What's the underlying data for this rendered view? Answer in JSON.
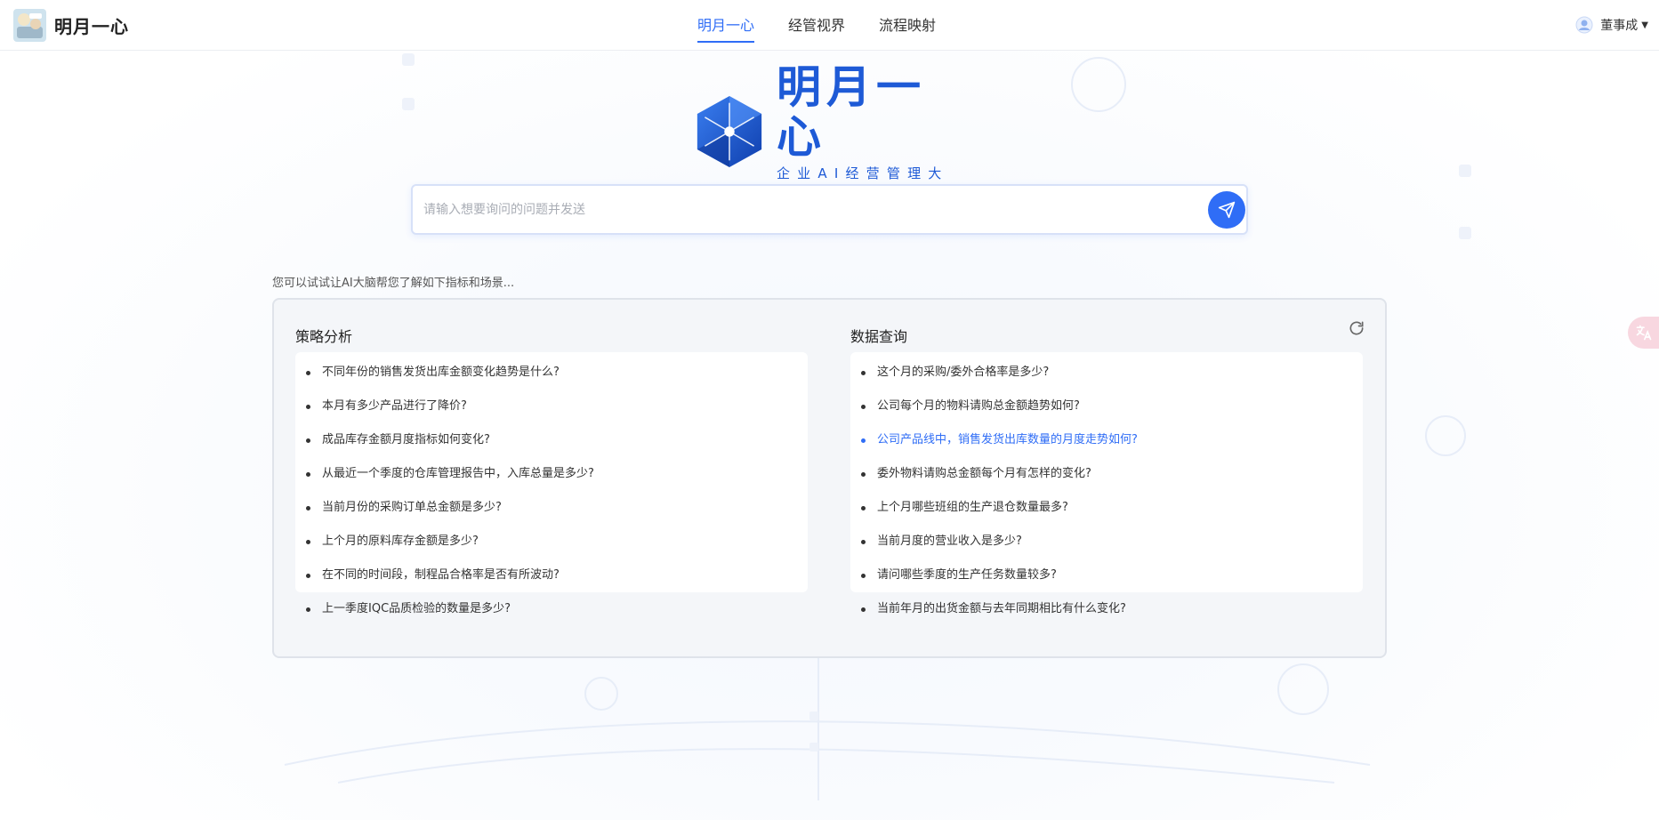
{
  "header": {
    "brand_name": "明月一心",
    "nav": [
      {
        "label": "明月一心",
        "active": true
      },
      {
        "label": "经管视界",
        "active": false
      },
      {
        "label": "流程映射",
        "active": false
      }
    ],
    "user_name": "董事成"
  },
  "hero": {
    "title": "明月一心",
    "subtitle": "企业AI经营管理大脑"
  },
  "search": {
    "placeholder": "请输入想要询问的问题并发送",
    "value": ""
  },
  "hint": "您可以试试让AI大脑帮您了解如下指标和场景...",
  "panels": {
    "left": {
      "title": "策略分析",
      "items": [
        "不同年份的销售发货出库金额变化趋势是什么?",
        "本月有多少产品进行了降价?",
        "成品库存金额月度指标如何变化?",
        "从最近一个季度的仓库管理报告中，入库总量是多少?",
        "当前月份的采购订单总金额是多少?",
        "上个月的原料库存金额是多少?",
        "在不同的时间段，制程品合格率是否有所波动?",
        "上一季度IQC品质检验的数量是多少?"
      ]
    },
    "right": {
      "title": "数据查询",
      "items": [
        "这个月的采购/委外合格率是多少?",
        "公司每个月的物料请购总金额趋势如何?",
        "公司产品线中，销售发货出库数量的月度走势如何?",
        "委外物料请购总金额每个月有怎样的变化?",
        "上个月哪些班组的生产退仓数量最多?",
        "当前月度的营业收入是多少?",
        "请问哪些季度的生产任务数量较多?",
        "当前年月的出货金额与去年同期相比有什么变化?"
      ],
      "highlighted_index": 2
    }
  },
  "colors": {
    "accent": "#2f6df6",
    "brand_blue": "#1e5ad6",
    "panel_bg": "#f4f6f9"
  },
  "icons": {
    "send": "paper-plane-icon",
    "refresh": "refresh-icon",
    "translate": "translate-icon",
    "user": "user-avatar-icon"
  }
}
